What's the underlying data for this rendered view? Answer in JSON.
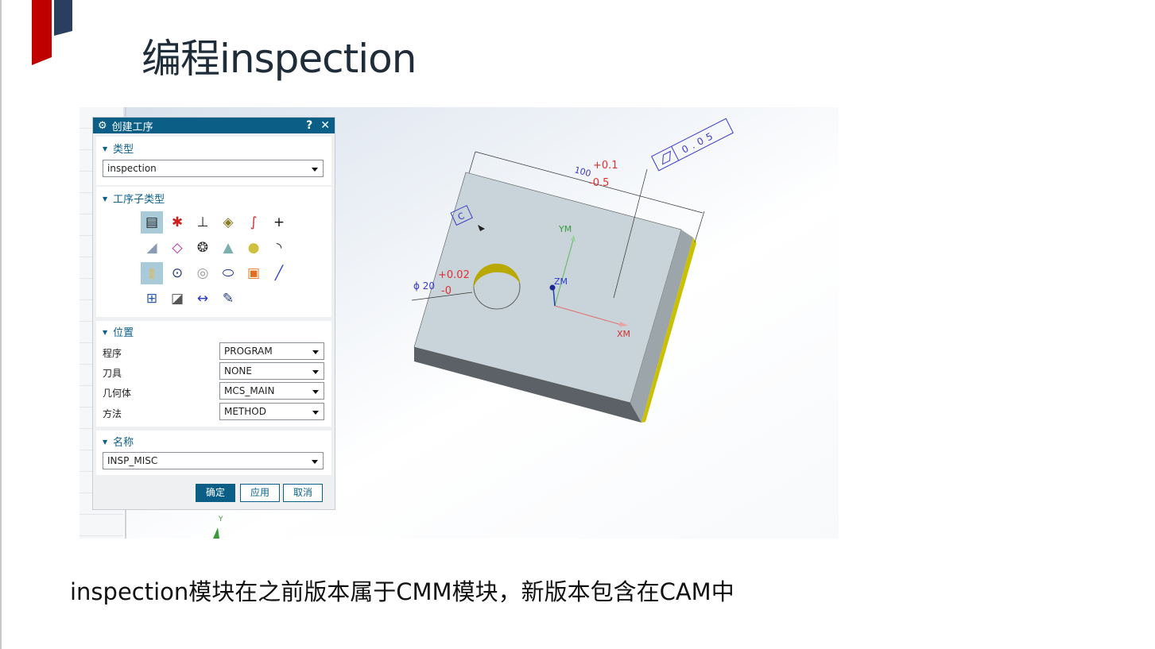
{
  "slide": {
    "title": "编程inspection",
    "caption": "inspection模块在之前版本属于CMM模块，新版本包含在CAM中",
    "accent_red": "#c00000",
    "accent_navy": "#2a3f5f"
  },
  "dialog": {
    "title": "创建工序",
    "help": "?",
    "close": "✕",
    "type_section": "类型",
    "type_value": "inspection",
    "subtype_section": "工序子类型",
    "subtype_icons": [
      "document",
      "points",
      "axis-ordinate",
      "cube-plane",
      "curve",
      "plus",
      "surface",
      "free-surface",
      "circle-pattern",
      "cone",
      "sphere",
      "arc",
      "cylinder",
      "circle",
      "torus",
      "slot",
      "pocket",
      "line",
      "probe",
      "section",
      "dimension",
      "edit"
    ],
    "position_section": "位置",
    "fields": [
      {
        "label": "程序",
        "value": "PROGRAM"
      },
      {
        "label": "刀具",
        "value": "NONE"
      },
      {
        "label": "几何体",
        "value": "MCS_MAIN"
      },
      {
        "label": "方法",
        "value": "METHOD"
      }
    ],
    "name_section": "名称",
    "name_value": "INSP_MISC",
    "ok": "确定",
    "apply": "应用",
    "cancel": "取消",
    "title_bar_color": "#0b5f86"
  },
  "viewport": {
    "dim_length": "100",
    "dim_upper": "+0.1",
    "dim_lower": "-0.5",
    "hole_dia": "ϕ 20",
    "hole_upper": "+0.02",
    "hole_lower": "-0",
    "datum": "C",
    "tolerance": "0.05",
    "axis_x": "XM",
    "axis_y": "YM",
    "axis_z": "ZM",
    "wcs_y": "Y"
  }
}
